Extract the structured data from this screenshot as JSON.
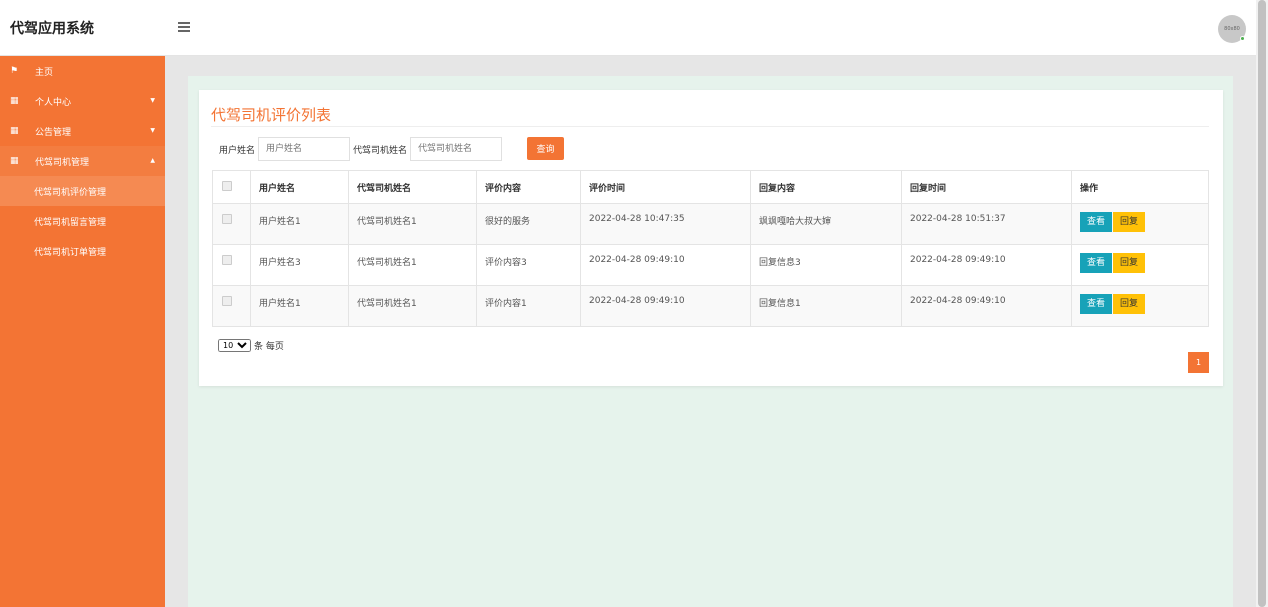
{
  "app": {
    "title": "代驾应用系统",
    "avatar_text": "80x80"
  },
  "sidebar": {
    "items": [
      {
        "label": "主页",
        "icon": "flag-icon"
      },
      {
        "label": "个人中心",
        "icon": "grid-icon"
      },
      {
        "label": "公告管理",
        "icon": "grid-icon"
      },
      {
        "label": "代驾司机管理",
        "icon": "grid-icon"
      }
    ],
    "sub_items": [
      "代驾司机评价管理",
      "代驾司机留言管理",
      "代驾司机订单管理"
    ]
  },
  "page": {
    "title": "代驾司机评价列表",
    "search": {
      "user_label": "用户姓名",
      "user_placeholder": "用户姓名",
      "driver_label": "代驾司机姓名",
      "driver_placeholder": "代驾司机姓名",
      "query_label": "查询"
    },
    "table": {
      "headers": [
        "用户姓名",
        "代驾司机姓名",
        "评价内容",
        "评价时间",
        "回复内容",
        "回复时间",
        "操作"
      ],
      "rows": [
        {
          "user": "用户姓名1",
          "driver": "代驾司机姓名1",
          "content": "很好的服务",
          "time": "2022-04-28 10:47:35",
          "reply": "飒飒嘎哈大叔大婶",
          "reply_time": "2022-04-28 10:51:37"
        },
        {
          "user": "用户姓名3",
          "driver": "代驾司机姓名1",
          "content": "评价内容3",
          "time": "2022-04-28 09:49:10",
          "reply": "回复信息3",
          "reply_time": "2022-04-28 09:49:10"
        },
        {
          "user": "用户姓名1",
          "driver": "代驾司机姓名1",
          "content": "评价内容1",
          "time": "2022-04-28 09:49:10",
          "reply": "回复信息1",
          "reply_time": "2022-04-28 09:49:10"
        }
      ],
      "view_label": "查看",
      "reply_label": "回复"
    },
    "pager": {
      "page_size": "10",
      "per_page_label": "条 每页",
      "current_page": "1"
    }
  },
  "colors": {
    "accent": "#f37434",
    "view_button": "#17a2b8",
    "reply_button": "#ffc107",
    "content_bg": "#e6f3ec"
  }
}
